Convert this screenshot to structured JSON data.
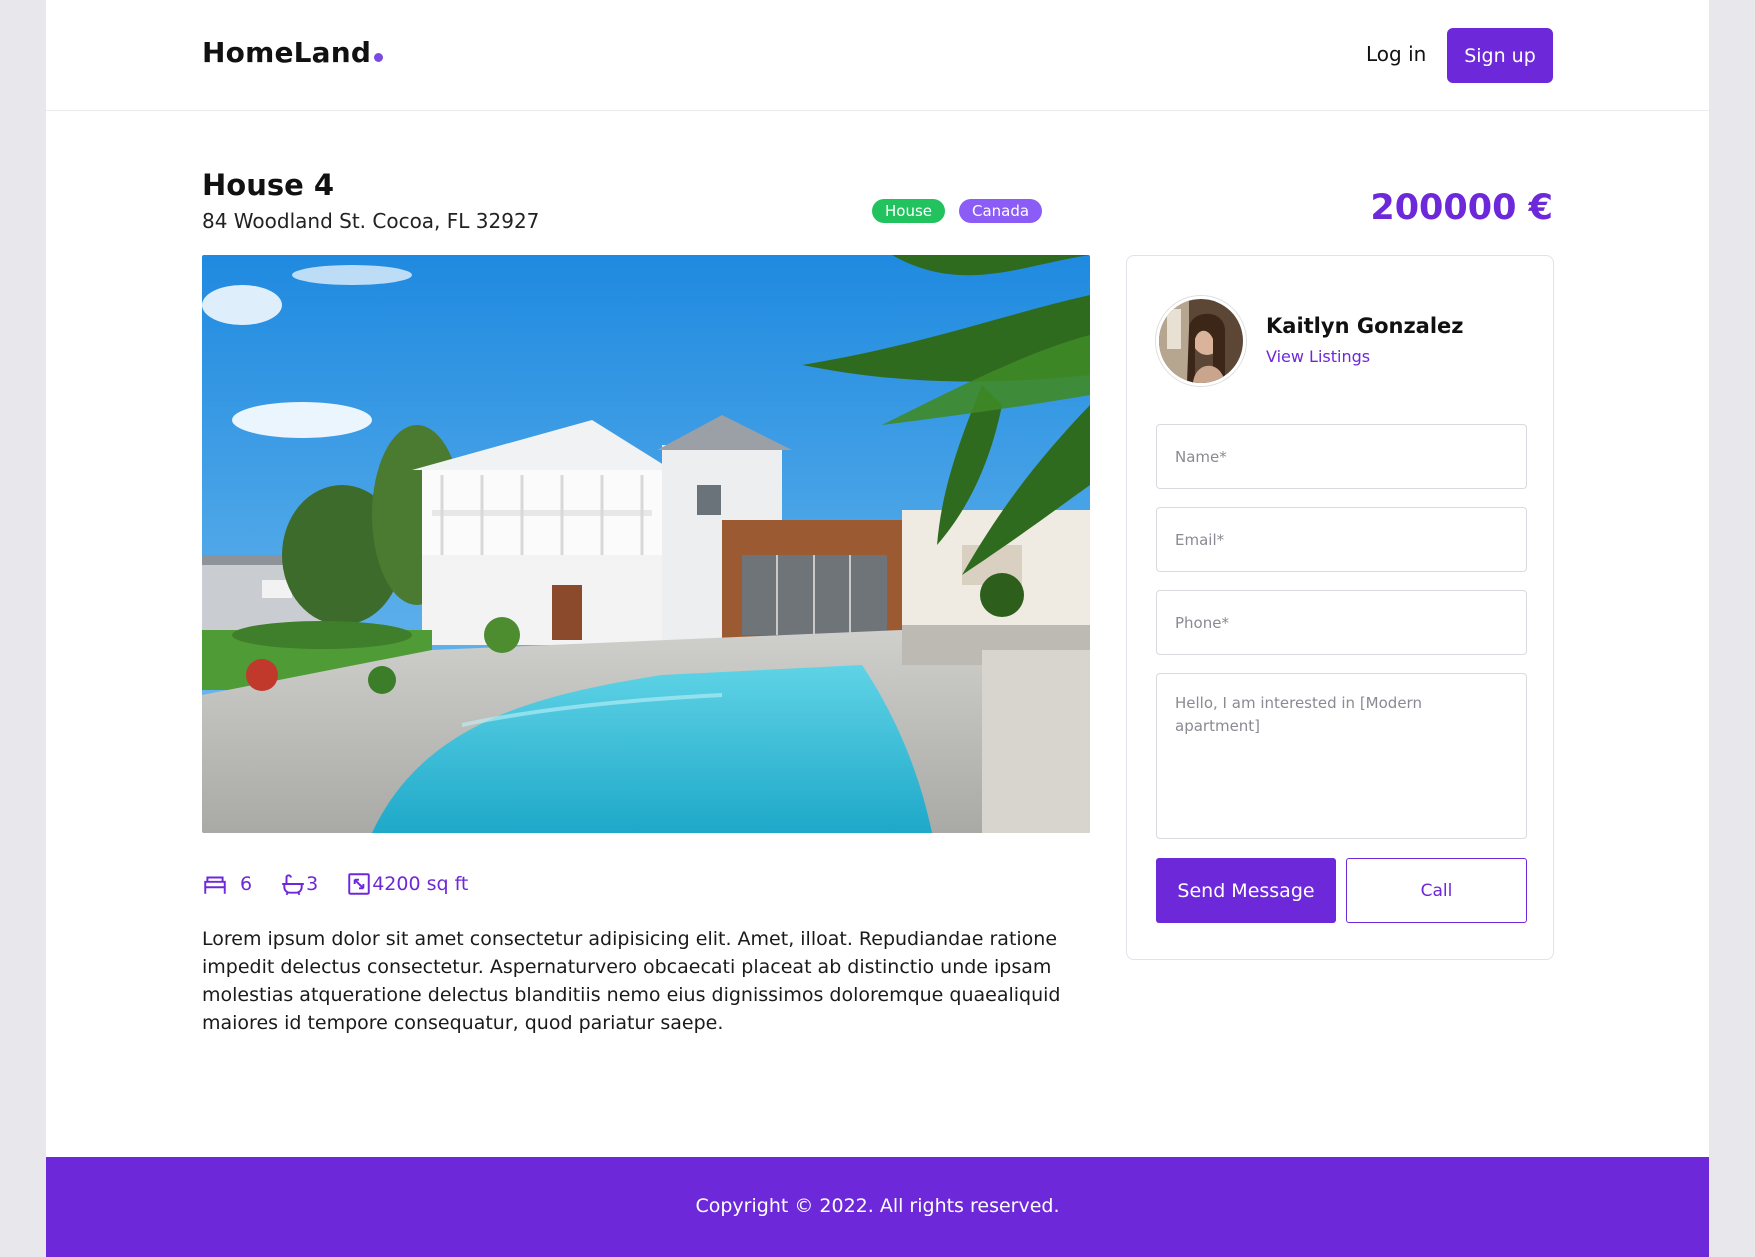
{
  "header": {
    "logo": "HomeLand",
    "login_label": "Log in",
    "signup_label": "Sign up"
  },
  "listing": {
    "title": "House 4",
    "address": "84 Woodland St. Cocoa, FL 32927",
    "tags": [
      "House",
      "Canada"
    ],
    "price": "200000 €",
    "features": {
      "beds": "6",
      "baths": "3",
      "area": "4200 sq ft"
    },
    "description": "Lorem ipsum dolor sit amet consectetur adipisicing elit. Amet, illoat. Repudiandae ratione impedit delectus consectetur. Aspernaturvero obcaecati placeat ab distinctio unde ipsam molestias atqueratione delectus blanditiis nemo eius dignissimos doloremque quaealiquid maiores id tempore consequatur, quod pariatur saepe."
  },
  "agent": {
    "name": "Kaitlyn Gonzalez",
    "view_listings": "View Listings"
  },
  "contact_form": {
    "name_placeholder": "Name*",
    "email_placeholder": "Email*",
    "phone_placeholder": "Phone*",
    "message_placeholder": "Hello, I am interested in [Modern apartment]",
    "send_label": "Send Message",
    "call_label": "Call"
  },
  "footer": {
    "copyright": "Copyright © 2022. All rights reserved."
  },
  "colors": {
    "primary": "#6d28d9",
    "tag_house": "#22c35e",
    "tag_canada": "#8b5cf6"
  },
  "icons": [
    "bed-icon",
    "bath-icon",
    "area-icon"
  ]
}
